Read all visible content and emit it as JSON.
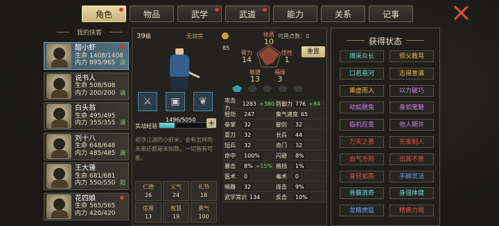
{
  "tabs": [
    "角色",
    "物品",
    "武学",
    "武道",
    "能力",
    "关系",
    "记事"
  ],
  "sidebar": {
    "title": "我的侠客",
    "heroes": [
      {
        "name": "醋小虾",
        "hp": "1408/1408",
        "mp": "895/965",
        "tag": "调",
        "dot": true,
        "selected": true
      },
      {
        "name": "说书人",
        "hp": "508/508",
        "mp": "200/200",
        "tag": "调",
        "dot": false,
        "selected": false
      },
      {
        "name": "白头翁",
        "hp": "495/495",
        "mp": "355/355",
        "tag": "调",
        "dot": false,
        "selected": false
      },
      {
        "name": "刘十八",
        "hp": "648/648",
        "mp": "485/485",
        "tag": "调",
        "dot": false,
        "selected": false
      },
      {
        "name": "王大锤",
        "hp": "681/681",
        "mp": "550/550",
        "tag": "阳",
        "dot": false,
        "selected": false
      },
      {
        "name": "花四娘",
        "hp": "565/565",
        "mp": "420/420",
        "tag": "",
        "dot": true,
        "selected": false
      }
    ],
    "hp_label": "生命",
    "mp_label": "内力"
  },
  "character": {
    "level": "39",
    "level_unit": "级",
    "sect": "无双宗",
    "potential": "85",
    "points_label": "可用点数：",
    "points": "0",
    "reset": "重置",
    "exp_label": "实战经验",
    "exp": "1496/5050",
    "exp_pct": 0.296,
    "desc": "初涉江湖的小虾米，会有怎样的未来还都是未知数，一切皆有可能。"
  },
  "attrs": [
    {
      "label": "体质",
      "value": "10"
    },
    {
      "label": "臂力",
      "value": "14"
    },
    {
      "label": "悟性",
      "value": "1"
    },
    {
      "label": "敏捷",
      "value": "13"
    },
    {
      "label": "福缘",
      "value": "3"
    }
  ],
  "virtues": [
    {
      "label": "仁德",
      "value": "26"
    },
    {
      "label": "义气",
      "value": "24"
    },
    {
      "label": "礼节",
      "value": "18"
    },
    {
      "label": "信用",
      "value": "13"
    },
    {
      "label": "智慧",
      "value": "19"
    },
    {
      "label": "勇气",
      "value": "100"
    }
  ],
  "stats": [
    [
      {
        "k": "攻击力",
        "v": "1283",
        "b": "+380"
      },
      {
        "k": "防御力",
        "v": "776",
        "b": "+84"
      }
    ],
    [
      {
        "k": "轻功",
        "v": "247",
        "b": ""
      },
      {
        "k": "集气速度",
        "v": "65",
        "b": ""
      }
    ],
    [
      {
        "k": "拳掌",
        "v": "32",
        "b": ""
      },
      {
        "k": "御剑",
        "v": "32",
        "b": ""
      }
    ],
    [
      {
        "k": "耍刀",
        "v": "32",
        "b": ""
      },
      {
        "k": "长兵",
        "v": "44",
        "b": ""
      }
    ],
    [
      {
        "k": "短兵",
        "v": "32",
        "b": ""
      },
      {
        "k": "奇门",
        "v": "32",
        "b": ""
      }
    ],
    [
      {
        "k": "命中",
        "v": "100%",
        "b": ""
      },
      {
        "k": "闪避",
        "v": "8%",
        "b": ""
      }
    ],
    [
      {
        "k": "暴击",
        "v": "8%",
        "b": "+15%"
      },
      {
        "k": "格挡",
        "v": "1%",
        "b": ""
      }
    ],
    [
      {
        "k": "医术",
        "v": "0",
        "b": ""
      },
      {
        "k": "毒术",
        "v": "0",
        "b": ""
      }
    ],
    [
      {
        "k": "暗器",
        "v": "32",
        "b": ""
      },
      {
        "k": "连击",
        "v": "9%",
        "b": ""
      }
    ],
    [
      {
        "k": "武学常识",
        "v": "134",
        "b": ""
      },
      {
        "k": "反击",
        "v": "10%",
        "b": ""
      }
    ]
  ],
  "status": {
    "title": "获得状态",
    "items": [
      {
        "t": "博采众长",
        "c": "c1"
      },
      {
        "t": "师父教骂",
        "c": "c4"
      },
      {
        "t": "口若悬河",
        "c": "c1"
      },
      {
        "t": "志得意满",
        "c": "c4"
      },
      {
        "t": "乘虚而入",
        "c": "c4"
      },
      {
        "t": "以力破巧",
        "c": "c2"
      },
      {
        "t": "动如脱兔",
        "c": "c2"
      },
      {
        "t": "身如鬼魅",
        "c": "c2"
      },
      {
        "t": "临机应变",
        "c": "c2"
      },
      {
        "t": "他人期许",
        "c": "c2"
      },
      {
        "t": "万夫之勇",
        "c": "c3"
      },
      {
        "t": "先发制人",
        "c": "c3"
      },
      {
        "t": "血气方刚",
        "c": "c3"
      },
      {
        "t": "出其不意",
        "c": "c3"
      },
      {
        "t": "身轻如燕",
        "c": "c3"
      },
      {
        "t": "手脚灵活",
        "c": "c5"
      },
      {
        "t": "骨骼清奇",
        "c": "c1"
      },
      {
        "t": "身强体健",
        "c": "c1"
      },
      {
        "t": "龙精虎猛",
        "c": "c5"
      },
      {
        "t": "精疲力竭",
        "c": "c3"
      }
    ]
  }
}
